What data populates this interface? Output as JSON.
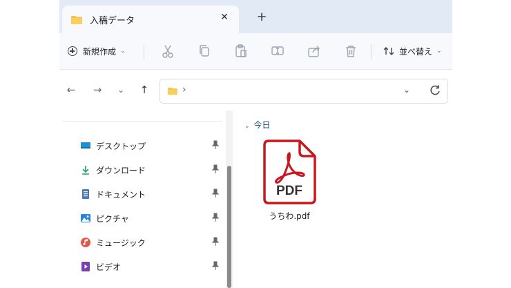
{
  "tab": {
    "title": "入稿データ",
    "close": "✕"
  },
  "new_tab": "+",
  "toolbar": {
    "new_label": "新規作成",
    "sort_label": "並べ替え",
    "chevron": "⌄"
  },
  "nav": {
    "back": "←",
    "forward": "→",
    "recent": "⌄",
    "up": "↑"
  },
  "address": {
    "separator": "›",
    "chevron": "⌄"
  },
  "sidebar": {
    "items": [
      {
        "label": "デスクトップ",
        "icon": "desktop-icon"
      },
      {
        "label": "ダウンロード",
        "icon": "download-icon"
      },
      {
        "label": "ドキュメント",
        "icon": "documents-icon"
      },
      {
        "label": "ピクチャ",
        "icon": "pictures-icon"
      },
      {
        "label": "ミュージック",
        "icon": "music-icon"
      },
      {
        "label": "ビデオ",
        "icon": "videos-icon"
      }
    ]
  },
  "content": {
    "group_label": "今日",
    "files": [
      {
        "name": "うちわ.pdf",
        "badge": "PDF"
      }
    ]
  },
  "colors": {
    "accent": "#0067c0",
    "pdf_red": "#c8171e",
    "folder": "#f5c043"
  }
}
